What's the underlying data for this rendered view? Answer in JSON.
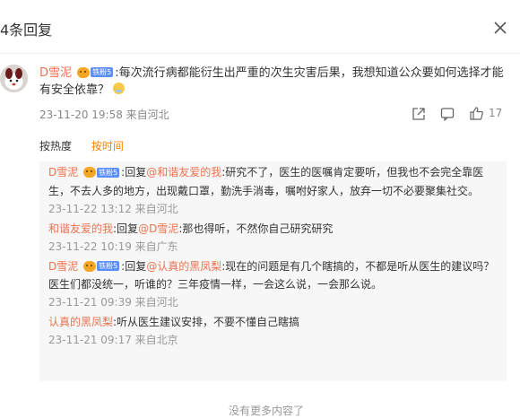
{
  "header": {
    "title": "4条回复"
  },
  "icons": {
    "close": "close-icon",
    "share": "share-icon",
    "comment": "comment-icon",
    "like": "thumbs-up-icon"
  },
  "colors": {
    "username": "#eb7350",
    "active_sort": "#ff8200",
    "meta": "#888888",
    "reply_bg": "#f7f7f7",
    "fan_badge": "#5b8ff9"
  },
  "main_comment": {
    "username": "D雪泥",
    "fan_badge": "铁粉5",
    "text": ":每次流行病都能衍生出严重的次生灾害后果，我想知道公众要如何选择才能有安全依靠？",
    "timestamp": "23-11-20 19:58 来自河北",
    "like_count": "17"
  },
  "sort": {
    "hot": "按热度",
    "time": "按时间"
  },
  "replies": [
    {
      "username": "D雪泥",
      "fan_badge": "铁粉5",
      "reply_prefix": ":回复",
      "mention": "@和谐友爱的我",
      "text": ":研究不了，医生的医嘱肯定要听，但我也不会完全靠医生，不去人多的地方，出现戴口罩，勤洗手消毒，嘱咐好家人，放弃一切不必要聚集社交。",
      "timestamp": "23-11-22 13:12 来自河北"
    },
    {
      "username": "和谐友爱的我",
      "reply_prefix": ":回复",
      "mention": "@D雪泥",
      "text": ":那也得听，不然你自己研究研究",
      "timestamp": "23-11-22 10:19 来自广东"
    },
    {
      "username": "D雪泥",
      "fan_badge": "铁粉5",
      "reply_prefix": ":回复",
      "mention": "@认真的黑凤梨",
      "text": ":现在的问题是有几个瞎搞的，不都是听从医生的建议吗？医生们都没统一，听谁的？三年疫情一样，一会这么说，一会那么说。",
      "timestamp": "23-11-21 09:39 来自河北"
    },
    {
      "username": "认真的黑凤梨",
      "text": ":听从医生建议安排，不要不懂自己瞎搞",
      "timestamp": "23-11-21 09:17 来自北京"
    }
  ],
  "footer": {
    "more": "没有更多内容了"
  }
}
